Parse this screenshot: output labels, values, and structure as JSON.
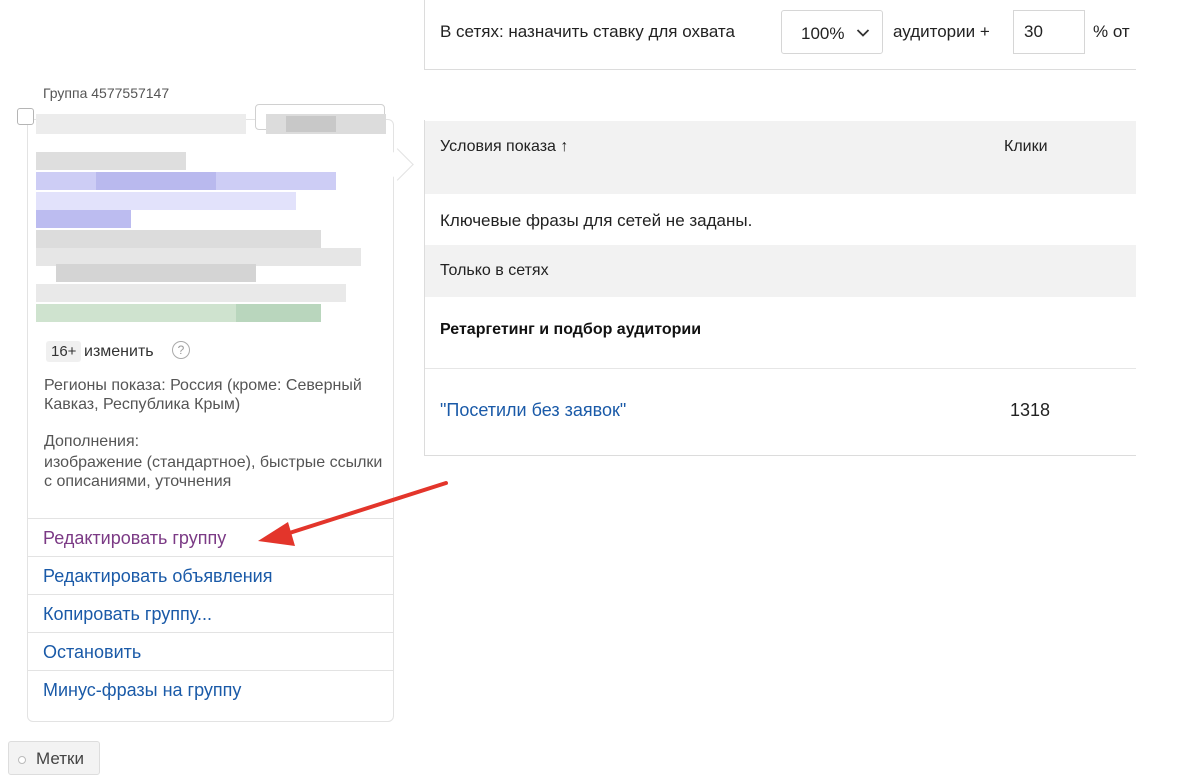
{
  "bid_settings": {
    "label": "В сетях:  назначить ставку для охвата",
    "coverage_value": "100%",
    "audience_label": "аудитории +",
    "bid_input_value": "30",
    "percent_label": "% от"
  },
  "group": {
    "title": "Группа 4577557147",
    "age_badge": "16+",
    "age_change": "изменить",
    "help_icon": "?",
    "regions": "Регионы показа: Россия (кроме: Северный Кавказ, Республика Крым)",
    "extensions_title": "Дополнения:",
    "extensions": "изображение (стандартное), быстрые ссылки с описаниями, уточнения"
  },
  "group_menu": {
    "edit_group": "Редактировать группу",
    "edit_ads": "Редактировать объявления",
    "copy_group": "Копировать группу...",
    "stop": "Остановить",
    "minus_phrases": "Минус-фразы на группу"
  },
  "tags_button": "Метки",
  "table": {
    "col_conditions": "Условия показа ↑",
    "col_clicks": "Клики",
    "empty_message": "Ключевые фразы для сетей не заданы.",
    "section_networks": "Только в сетях",
    "section_retargeting": "Ретаргетинг и подбор аудитории",
    "rows": [
      {
        "name": "\"Посетили без заявок\"",
        "clicks": "1318"
      }
    ]
  },
  "colors": {
    "link": "#1a5aa8",
    "visited_link": "#7b3a85",
    "annotation_arrow": "#e3352b",
    "header_bg": "#f2f2f2"
  }
}
